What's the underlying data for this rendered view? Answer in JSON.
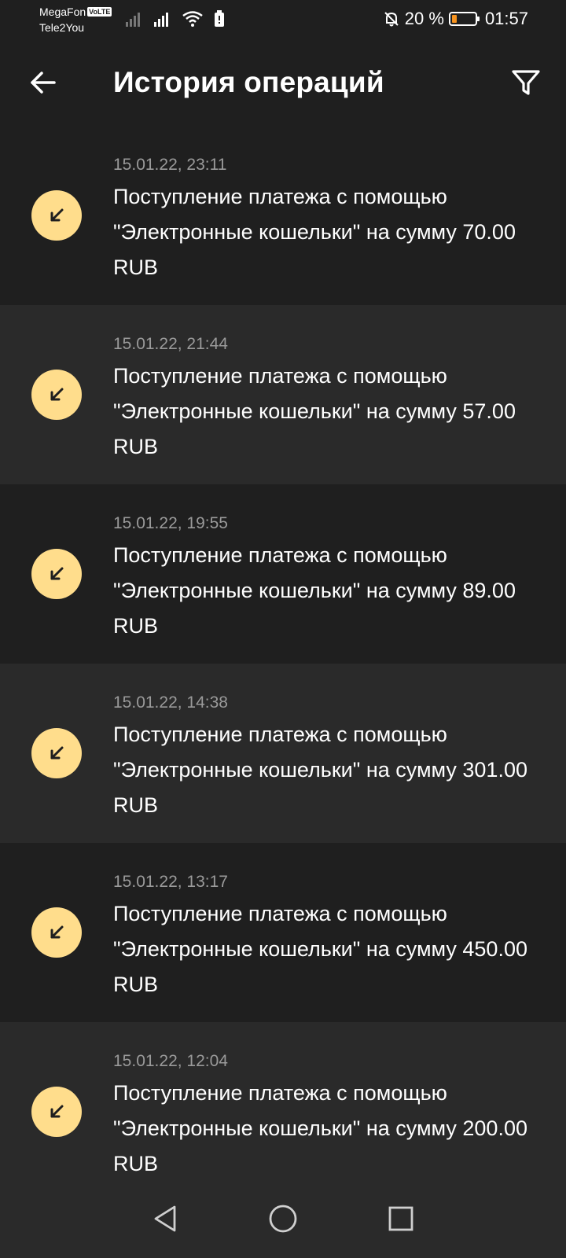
{
  "status_bar": {
    "carrier_1": "MegaFon",
    "volte": "VoLTE",
    "carrier_2": "Tele2You",
    "battery_text": "20 %",
    "battery_level": 0.2,
    "time": "01:57"
  },
  "app_bar": {
    "title": "История операций",
    "back_icon": "arrow-left-icon",
    "filter_icon": "filter-icon"
  },
  "operations": [
    {
      "date": "15.01.22, 23:11",
      "description": "Поступление платежа с помощью \"Электронные кошельки\" на сумму 70.00 RUB"
    },
    {
      "date": "15.01.22, 21:44",
      "description": "Поступление платежа с помощью \"Электронные кошельки\" на сумму 57.00 RUB"
    },
    {
      "date": "15.01.22, 19:55",
      "description": "Поступление платежа с помощью \"Электронные кошельки\" на сумму 89.00 RUB"
    },
    {
      "date": "15.01.22, 14:38",
      "description": "Поступление платежа с помощью \"Электронные кошельки\" на сумму 301.00 RUB"
    },
    {
      "date": "15.01.22, 13:17",
      "description": "Поступление платежа с помощью \"Электронные кошельки\" на сумму 450.00 RUB"
    },
    {
      "date": "15.01.22, 12:04",
      "description": "Поступление платежа с помощью \"Электронные кошельки\" на сумму 200.00 RUB"
    }
  ],
  "colors": {
    "background": "#1f1f1f",
    "row_alt": "#2a2a2a",
    "icon_badge": "#ffdd8c",
    "date_text": "#9a9a9a"
  }
}
